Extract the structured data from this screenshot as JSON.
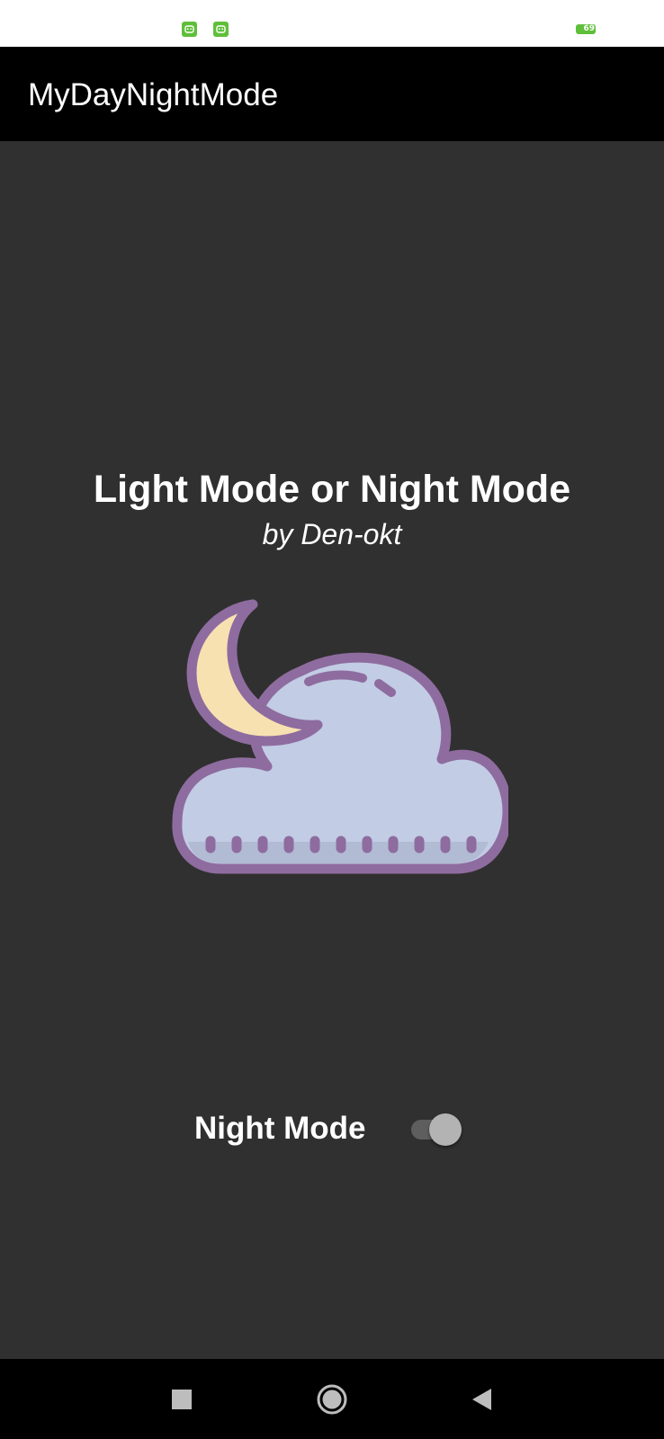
{
  "status_bar": {
    "notification_icons": [
      "android-icon",
      "android-icon"
    ],
    "battery_level": "69",
    "icon_color": "#5fbf3a"
  },
  "app_bar": {
    "title": "MyDayNightMode"
  },
  "main": {
    "heading": "Light Mode or Night Mode",
    "byline": "by Den-okt",
    "illustration_icon": "moon-cloud-icon",
    "night_mode": {
      "label": "Night Mode",
      "checked": true
    }
  },
  "navigation_bar": {
    "buttons": [
      "recents-icon",
      "home-icon",
      "back-icon"
    ]
  },
  "colors": {
    "background": "#303030",
    "app_bar": "#000000",
    "cloud_fill": "#c2cce4",
    "moon_fill": "#f7e1b1",
    "outline": "#8e6c9f",
    "switch_track": "#5e5e5e",
    "switch_thumb": "#b3b3b3"
  }
}
